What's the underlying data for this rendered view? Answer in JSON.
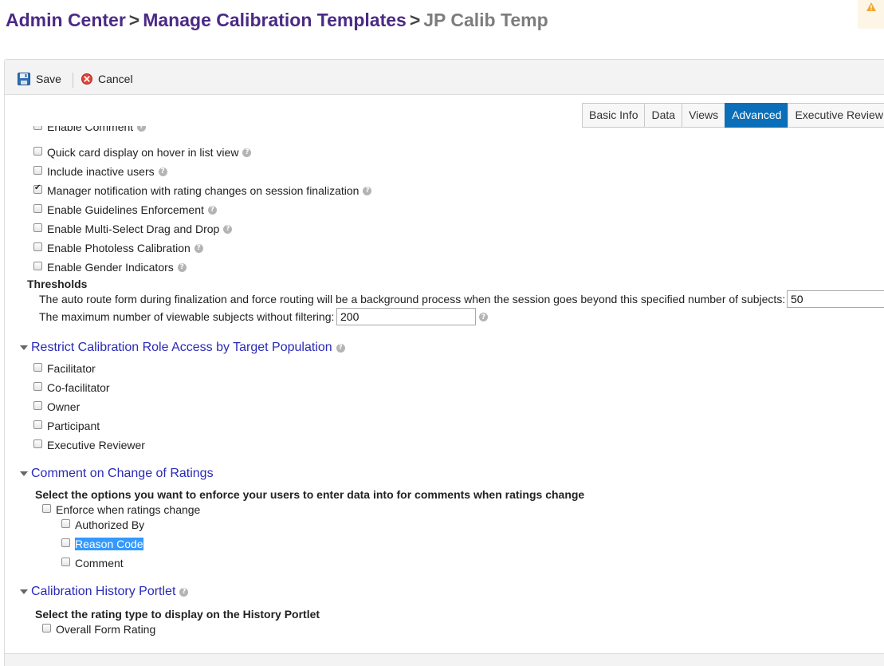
{
  "breadcrumb": {
    "admin_center": "Admin Center",
    "manage_templates": "Manage Calibration Templates",
    "current": "JP Calib Temp",
    "separator": ">"
  },
  "toolbar": {
    "save_label": "Save",
    "cancel_label": "Cancel"
  },
  "tabs": {
    "basic_info": "Basic Info",
    "data": "Data",
    "views": "Views",
    "advanced": "Advanced",
    "executive_review": "Executive Review",
    "active": "Advanced"
  },
  "options": {
    "enable_comment": {
      "label": "Enable Comment",
      "checked": false
    },
    "quick_card": {
      "label": "Quick card display on hover in list view",
      "checked": false
    },
    "include_inactive": {
      "label": "Include inactive users",
      "checked": false
    },
    "manager_notification": {
      "label": "Manager notification with rating changes on session finalization",
      "checked": true
    },
    "guidelines": {
      "label": "Enable Guidelines Enforcement",
      "checked": false
    },
    "multi_select": {
      "label": "Enable Multi-Select Drag and Drop",
      "checked": false
    },
    "photoless": {
      "label": "Enable Photoless Calibration",
      "checked": false
    },
    "gender": {
      "label": "Enable Gender Indicators",
      "checked": false
    }
  },
  "thresholds": {
    "title": "Thresholds",
    "auto_route_label": "The auto route form during finalization and force routing will be a background process when the session goes beyond this specified number of subjects:",
    "auto_route_value": "50",
    "max_viewable_label": "The maximum number of viewable subjects without filtering:",
    "max_viewable_value": "200"
  },
  "restrict": {
    "title": "Restrict Calibration Role Access by Target Population",
    "roles": [
      {
        "label": "Facilitator",
        "checked": false
      },
      {
        "label": "Co-facilitator",
        "checked": false
      },
      {
        "label": "Owner",
        "checked": false
      },
      {
        "label": "Participant",
        "checked": false
      },
      {
        "label": "Executive Reviewer",
        "checked": false
      }
    ]
  },
  "comment_change": {
    "title": "Comment on Change of Ratings",
    "instruction": "Select the options you want to enforce your users to enter data into for comments when ratings change",
    "enforce_label": "Enforce when ratings change",
    "fields": [
      {
        "label": "Authorized By",
        "checked": false
      },
      {
        "label": "Reason Code",
        "checked": false,
        "selected": true
      },
      {
        "label": "Comment",
        "checked": false
      }
    ]
  },
  "history": {
    "title": "Calibration History Portlet",
    "instruction": "Select the rating type to display on the History Portlet",
    "overall_label": "Overall Form Rating"
  },
  "colors": {
    "breadcrumb_link": "#4b2a85",
    "breadcrumb_current": "#7d7d7d",
    "section_link": "#2a2ab8",
    "active_tab": "#0a6fb8",
    "selection": "#3399ff"
  }
}
